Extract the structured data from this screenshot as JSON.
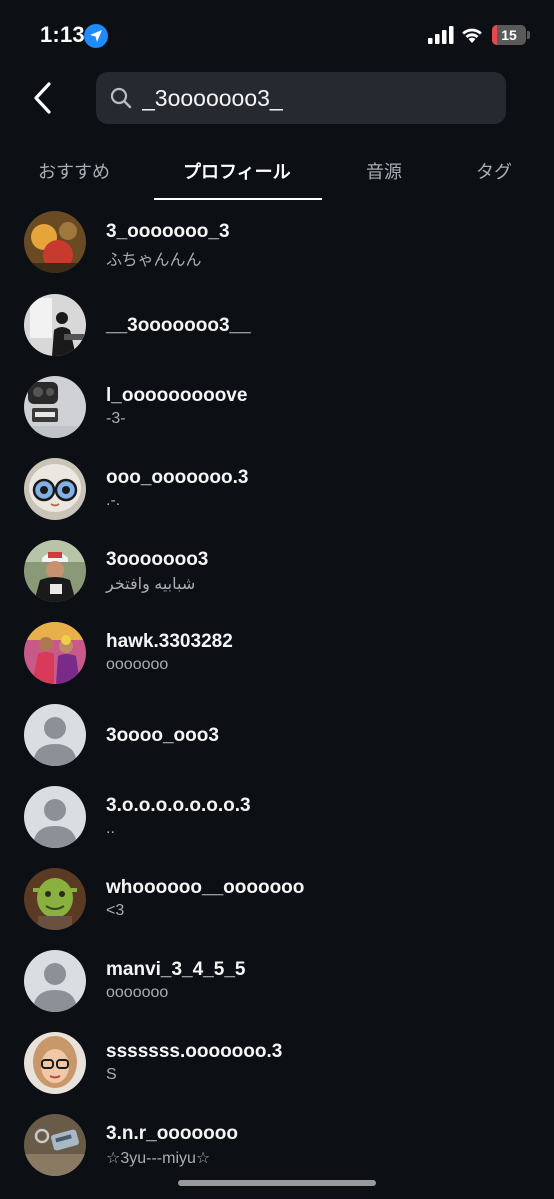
{
  "status_bar": {
    "time": "1:13",
    "battery_level": "15",
    "battery_fraction": 0.15,
    "location_icon": "location-arrow-icon",
    "signal_icon": "cellular-signal-icon",
    "wifi_icon": "wifi-icon",
    "battery_color": "#e5484d"
  },
  "header": {
    "back_icon": "chevron-left-icon",
    "search_query": "_3ooooooo3_",
    "search_icon": "search-icon"
  },
  "tabs": [
    {
      "label": "おすすめ",
      "active": false
    },
    {
      "label": "プロフィール",
      "active": true
    },
    {
      "label": "音源",
      "active": false
    },
    {
      "label": "タグ",
      "active": false
    }
  ],
  "results": [
    {
      "username": "3_ooooooo_3",
      "subtitle": "ふちゃんんん"
    },
    {
      "username": "__3ooooooo3__",
      "subtitle": ""
    },
    {
      "username": "l_ooooooooove",
      "subtitle": "-3-"
    },
    {
      "username": "ooo_ooooooo.3",
      "subtitle": ".-."
    },
    {
      "username": "3ooooooo3",
      "subtitle": "شبابيه وافتخر"
    },
    {
      "username": "hawk.3303282",
      "subtitle": "ooooooo"
    },
    {
      "username": "3oooo_ooo3",
      "subtitle": ""
    },
    {
      "username": "3.o.o.o.o.o.o.o.3",
      "subtitle": ".."
    },
    {
      "username": "whoooooo__ooooooo",
      "subtitle": "<3"
    },
    {
      "username": "manvi_3_4_5_5",
      "subtitle": "ooooooo"
    },
    {
      "username": "sssssss.ooooooo.3",
      "subtitle": "S"
    },
    {
      "username": "3.n.r_ooooooo",
      "subtitle": "☆3yu---miyu☆"
    }
  ],
  "colors": {
    "background": "#0c1014",
    "search_field": "#262a30",
    "secondary_text": "#a8aeb5",
    "accent_blue": "#1e8bff"
  }
}
